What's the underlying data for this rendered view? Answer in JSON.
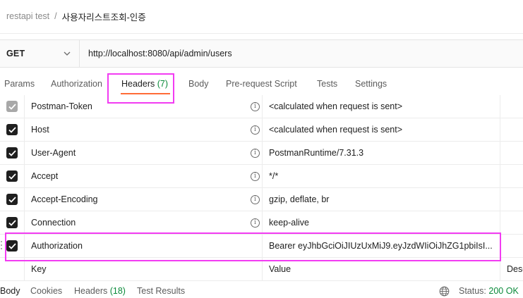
{
  "breadcrumb": {
    "parent": "restapi test",
    "separator": "/",
    "current": "사용자리스트조회-인증"
  },
  "request": {
    "method": "GET",
    "url": "http://localhost:8080/api/admin/users"
  },
  "tabs": {
    "params": "Params",
    "authorization": "Authorization",
    "headers": "Headers",
    "headers_count": "(7)",
    "body": "Body",
    "pre_request": "Pre-request Script",
    "tests": "Tests",
    "settings": "Settings"
  },
  "headers": [
    {
      "key": "Postman-Token",
      "value": "<calculated when request is sent>",
      "checked": true,
      "disabled": true
    },
    {
      "key": "Host",
      "value": "<calculated when request is sent>",
      "checked": true,
      "disabled": false
    },
    {
      "key": "User-Agent",
      "value": "PostmanRuntime/7.31.3",
      "checked": true,
      "disabled": false
    },
    {
      "key": "Accept",
      "value": "*/*",
      "checked": true,
      "disabled": false
    },
    {
      "key": "Accept-Encoding",
      "value": "gzip, deflate, br",
      "checked": true,
      "disabled": false
    },
    {
      "key": "Connection",
      "value": "keep-alive",
      "checked": true,
      "disabled": false
    },
    {
      "key": "Authorization",
      "value": "Bearer eyJhbGciOiJIUzUxMiJ9.eyJzdWIiOiJhZG1pbiIsI...",
      "checked": true,
      "disabled": false
    }
  ],
  "new_row": {
    "key_placeholder": "Key",
    "value_placeholder": "Value",
    "desc_placeholder": "Desc"
  },
  "response": {
    "body": "Body",
    "cookies": "Cookies",
    "headers": "Headers",
    "headers_count": "(18)",
    "test_results": "Test Results",
    "status_label": "Status:",
    "status_value": "200 OK"
  },
  "colors": {
    "accent": "#ff6c37",
    "success": "#0a8a3a",
    "highlight": "#f23cf2"
  }
}
